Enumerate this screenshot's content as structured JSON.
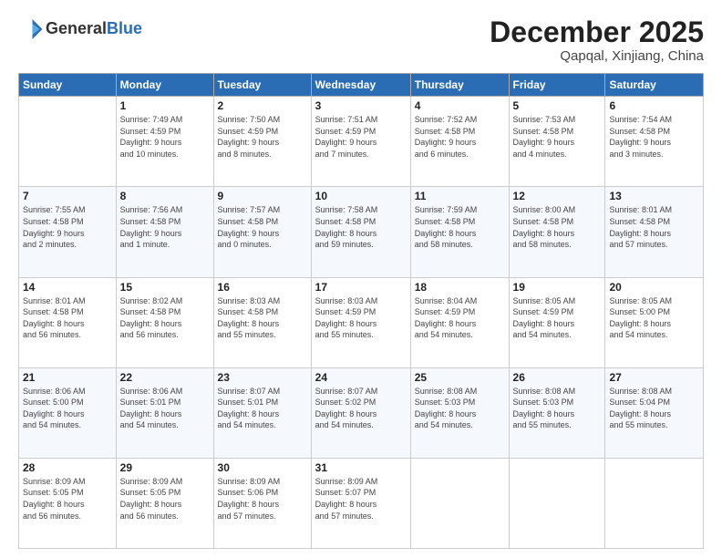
{
  "header": {
    "logo_line1": "General",
    "logo_line2": "Blue",
    "month": "December 2025",
    "location": "Qapqal, Xinjiang, China"
  },
  "weekdays": [
    "Sunday",
    "Monday",
    "Tuesday",
    "Wednesday",
    "Thursday",
    "Friday",
    "Saturday"
  ],
  "weeks": [
    [
      {
        "num": "",
        "info": ""
      },
      {
        "num": "1",
        "info": "Sunrise: 7:49 AM\nSunset: 4:59 PM\nDaylight: 9 hours\nand 10 minutes."
      },
      {
        "num": "2",
        "info": "Sunrise: 7:50 AM\nSunset: 4:59 PM\nDaylight: 9 hours\nand 8 minutes."
      },
      {
        "num": "3",
        "info": "Sunrise: 7:51 AM\nSunset: 4:59 PM\nDaylight: 9 hours\nand 7 minutes."
      },
      {
        "num": "4",
        "info": "Sunrise: 7:52 AM\nSunset: 4:58 PM\nDaylight: 9 hours\nand 6 minutes."
      },
      {
        "num": "5",
        "info": "Sunrise: 7:53 AM\nSunset: 4:58 PM\nDaylight: 9 hours\nand 4 minutes."
      },
      {
        "num": "6",
        "info": "Sunrise: 7:54 AM\nSunset: 4:58 PM\nDaylight: 9 hours\nand 3 minutes."
      }
    ],
    [
      {
        "num": "7",
        "info": "Sunrise: 7:55 AM\nSunset: 4:58 PM\nDaylight: 9 hours\nand 2 minutes."
      },
      {
        "num": "8",
        "info": "Sunrise: 7:56 AM\nSunset: 4:58 PM\nDaylight: 9 hours\nand 1 minute."
      },
      {
        "num": "9",
        "info": "Sunrise: 7:57 AM\nSunset: 4:58 PM\nDaylight: 9 hours\nand 0 minutes."
      },
      {
        "num": "10",
        "info": "Sunrise: 7:58 AM\nSunset: 4:58 PM\nDaylight: 8 hours\nand 59 minutes."
      },
      {
        "num": "11",
        "info": "Sunrise: 7:59 AM\nSunset: 4:58 PM\nDaylight: 8 hours\nand 58 minutes."
      },
      {
        "num": "12",
        "info": "Sunrise: 8:00 AM\nSunset: 4:58 PM\nDaylight: 8 hours\nand 58 minutes."
      },
      {
        "num": "13",
        "info": "Sunrise: 8:01 AM\nSunset: 4:58 PM\nDaylight: 8 hours\nand 57 minutes."
      }
    ],
    [
      {
        "num": "14",
        "info": "Sunrise: 8:01 AM\nSunset: 4:58 PM\nDaylight: 8 hours\nand 56 minutes."
      },
      {
        "num": "15",
        "info": "Sunrise: 8:02 AM\nSunset: 4:58 PM\nDaylight: 8 hours\nand 56 minutes."
      },
      {
        "num": "16",
        "info": "Sunrise: 8:03 AM\nSunset: 4:58 PM\nDaylight: 8 hours\nand 55 minutes."
      },
      {
        "num": "17",
        "info": "Sunrise: 8:03 AM\nSunset: 4:59 PM\nDaylight: 8 hours\nand 55 minutes."
      },
      {
        "num": "18",
        "info": "Sunrise: 8:04 AM\nSunset: 4:59 PM\nDaylight: 8 hours\nand 54 minutes."
      },
      {
        "num": "19",
        "info": "Sunrise: 8:05 AM\nSunset: 4:59 PM\nDaylight: 8 hours\nand 54 minutes."
      },
      {
        "num": "20",
        "info": "Sunrise: 8:05 AM\nSunset: 5:00 PM\nDaylight: 8 hours\nand 54 minutes."
      }
    ],
    [
      {
        "num": "21",
        "info": "Sunrise: 8:06 AM\nSunset: 5:00 PM\nDaylight: 8 hours\nand 54 minutes."
      },
      {
        "num": "22",
        "info": "Sunrise: 8:06 AM\nSunset: 5:01 PM\nDaylight: 8 hours\nand 54 minutes."
      },
      {
        "num": "23",
        "info": "Sunrise: 8:07 AM\nSunset: 5:01 PM\nDaylight: 8 hours\nand 54 minutes."
      },
      {
        "num": "24",
        "info": "Sunrise: 8:07 AM\nSunset: 5:02 PM\nDaylight: 8 hours\nand 54 minutes."
      },
      {
        "num": "25",
        "info": "Sunrise: 8:08 AM\nSunset: 5:03 PM\nDaylight: 8 hours\nand 54 minutes."
      },
      {
        "num": "26",
        "info": "Sunrise: 8:08 AM\nSunset: 5:03 PM\nDaylight: 8 hours\nand 55 minutes."
      },
      {
        "num": "27",
        "info": "Sunrise: 8:08 AM\nSunset: 5:04 PM\nDaylight: 8 hours\nand 55 minutes."
      }
    ],
    [
      {
        "num": "28",
        "info": "Sunrise: 8:09 AM\nSunset: 5:05 PM\nDaylight: 8 hours\nand 56 minutes."
      },
      {
        "num": "29",
        "info": "Sunrise: 8:09 AM\nSunset: 5:05 PM\nDaylight: 8 hours\nand 56 minutes."
      },
      {
        "num": "30",
        "info": "Sunrise: 8:09 AM\nSunset: 5:06 PM\nDaylight: 8 hours\nand 57 minutes."
      },
      {
        "num": "31",
        "info": "Sunrise: 8:09 AM\nSunset: 5:07 PM\nDaylight: 8 hours\nand 57 minutes."
      },
      {
        "num": "",
        "info": ""
      },
      {
        "num": "",
        "info": ""
      },
      {
        "num": "",
        "info": ""
      }
    ]
  ]
}
